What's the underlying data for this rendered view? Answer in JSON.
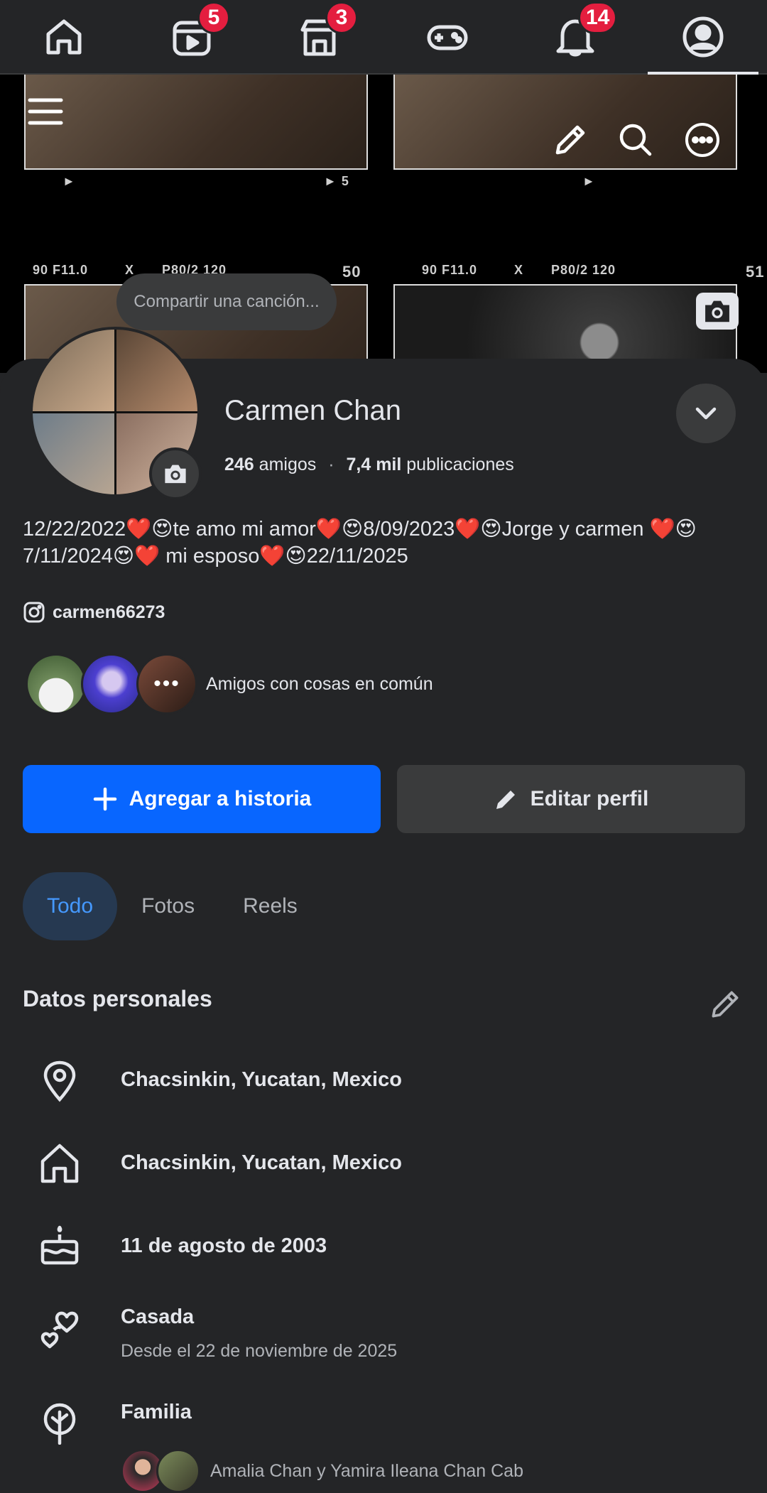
{
  "nav": {
    "items": [
      {
        "icon": "home-icon"
      },
      {
        "icon": "video-icon",
        "badge": "5"
      },
      {
        "icon": "marketplace-icon",
        "badge": "3"
      },
      {
        "icon": "gaming-icon"
      },
      {
        "icon": "bell-icon",
        "badge": "14"
      },
      {
        "icon": "profile-icon"
      }
    ]
  },
  "cover": {
    "film_labels": [
      "90 F11.0",
      "X",
      "P80/2 120",
      "50",
      "90 F11.0",
      "X",
      "P80/2 120",
      "51",
      "5"
    ],
    "song_placeholder": "Compartir una canción..."
  },
  "profile": {
    "name": "Carmen Chan",
    "friends_count": "246",
    "friends_label": "amigos",
    "posts_count": "7,4 mil",
    "posts_label": "publicaciones",
    "bio": "12/22/2022❤️😍te amo mi amor❤️😍8/09/2023❤️😍Jorge y carmen ❤️😍7/11/2024😍❤️ mi esposo❤️😍22/11/2025",
    "instagram": "carmen66273",
    "mutual_friends_text": "Amigos con cosas en común",
    "mutual_more": "•••"
  },
  "actions": {
    "add_story": "Agregar a historia",
    "edit_profile": "Editar perfil"
  },
  "tabs": [
    {
      "label": "Todo",
      "active": true
    },
    {
      "label": "Fotos",
      "active": false
    },
    {
      "label": "Reels",
      "active": false
    }
  ],
  "details": {
    "title": "Datos personales",
    "current_city": "Chacsinkin, Yucatan, Mexico",
    "hometown": "Chacsinkin, Yucatan, Mexico",
    "birthday": "11 de agosto de 2003",
    "relationship": "Casada",
    "relationship_since": "Desde el 22 de noviembre de 2025",
    "family_label": "Familia",
    "family_members": "Amalia Chan y Yamira Ileana Chan Cab"
  },
  "colors": {
    "background": "#242527",
    "primary_button": "#0866ff",
    "badge": "#e41e3f",
    "active_tab_bg": "#263951",
    "active_tab_text": "#4599ff"
  }
}
